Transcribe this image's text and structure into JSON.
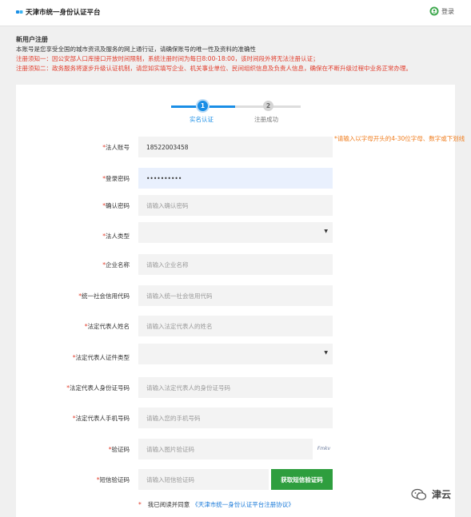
{
  "header": {
    "site_title": "天津市统一身份认证平台",
    "login_label": "登录"
  },
  "notice": {
    "heading": "新用户注册",
    "description": "本账号是您享受全国的城市资讯及服务的网上通行证，请确保账号的唯一性及资料的准确性",
    "warning_1": "注册须知一：因公安部人口库接口开放时间限制，系统注册时间为每日8:00-18:00，该时间段外将无法注册认证；",
    "warning_2": "注册须知二：政务服务将逐步升级认证机制，请您如实填写企业、机关事业单位、民间组织信息及负责人信息，确保在不断升级过程中业务正常办理。"
  },
  "steps": [
    {
      "number": "1",
      "label": "实名认证",
      "active": true
    },
    {
      "number": "2",
      "label": "注册成功",
      "active": false
    }
  ],
  "form": {
    "required_mark": "*",
    "account": {
      "label": "法人账号",
      "value": "18522003458",
      "hint": "*请输入以字母开头的4-30位字母、数字或下划线"
    },
    "password": {
      "label": "登录密码",
      "value": "••••••••••"
    },
    "confirm_password": {
      "label": "确认密码",
      "placeholder": "请输入确认密码"
    },
    "legal_type": {
      "label": "法人类型",
      "selected": ""
    },
    "company_name": {
      "label": "企业名称",
      "placeholder": "请输入企业名称"
    },
    "credit_code": {
      "label": "统一社会信用代码",
      "placeholder": "请输入统一社会信用代码"
    },
    "rep_name": {
      "label": "法定代表人姓名",
      "placeholder": "请输入法定代表人的姓名"
    },
    "rep_id_type": {
      "label": "法定代表人证件类型",
      "selected": ""
    },
    "rep_id_number": {
      "label": "法定代表人身份证号码",
      "placeholder": "请输入法定代表人的身份证号码"
    },
    "rep_phone": {
      "label": "法定代表人手机号码",
      "placeholder": "请输入您的手机号码"
    },
    "captcha": {
      "label": "验证码",
      "placeholder": "请输入图片验证码",
      "image_text": "Fmkv"
    },
    "sms": {
      "label": "短信验证码",
      "placeholder": "请输入短信验证码",
      "button_label": "获取短信验证码"
    },
    "agreement": {
      "text": "我已阅读并同意",
      "link": "《天津市统一身份认证平台注册协议》"
    }
  },
  "watermark": {
    "text": "津云"
  },
  "colors": {
    "primary_blue": "#1a8ee6",
    "warning_red": "#e23c2b",
    "hint_orange": "#f07d1e",
    "sms_green": "#2e9e3e"
  }
}
